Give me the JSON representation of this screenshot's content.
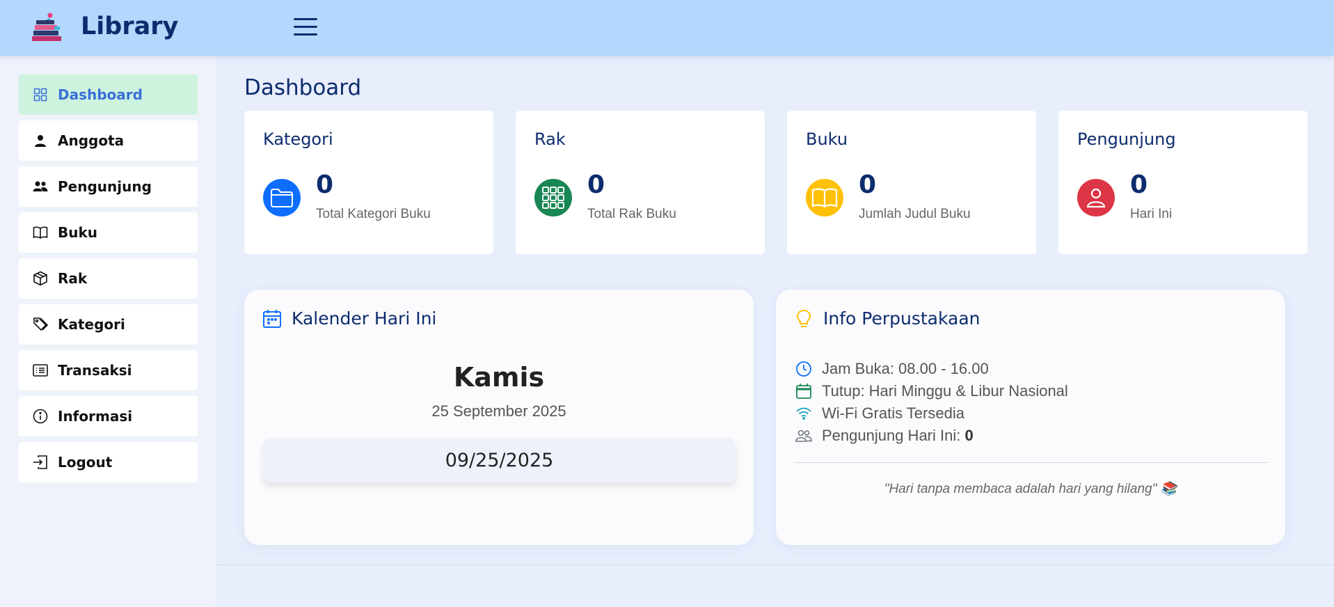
{
  "header": {
    "brand": "Library"
  },
  "sidebar": {
    "items": [
      {
        "label": "Dashboard",
        "icon": "grid-icon",
        "active": true
      },
      {
        "label": "Anggota",
        "icon": "person-icon"
      },
      {
        "label": "Pengunjung",
        "icon": "people-icon"
      },
      {
        "label": "Buku",
        "icon": "book-icon"
      },
      {
        "label": "Rak",
        "icon": "box-icon"
      },
      {
        "label": "Kategori",
        "icon": "tags-icon"
      },
      {
        "label": "Transaksi",
        "icon": "list-icon"
      },
      {
        "label": "Informasi",
        "icon": "info-icon"
      },
      {
        "label": "Logout",
        "icon": "logout-icon"
      }
    ]
  },
  "main": {
    "title": "Dashboard",
    "cards": [
      {
        "title": "Kategori",
        "value": "0",
        "subtitle": "Total Kategori Buku",
        "color": "#0d6efd",
        "icon": "folder-icon"
      },
      {
        "title": "Rak",
        "value": "0",
        "subtitle": "Total Rak Buku",
        "color": "#198754",
        "icon": "grid-3x3-icon"
      },
      {
        "title": "Buku",
        "value": "0",
        "subtitle": "Jumlah Judul Buku",
        "color": "#ffc107",
        "icon": "open-book-icon"
      },
      {
        "title": "Pengunjung",
        "value": "0",
        "subtitle": "Hari Ini",
        "color": "#dc3545",
        "icon": "person-circle-icon"
      }
    ],
    "calendar": {
      "title": "Kalender Hari Ini",
      "day": "Kamis",
      "date_long": "25 September 2025",
      "date_short": "09/25/2025"
    },
    "info": {
      "title": "Info Perpustakaan",
      "rows": [
        {
          "text": "Jam Buka: 08.00 - 16.00",
          "icon": "clock-icon"
        },
        {
          "text": "Tutup: Hari Minggu & Libur Nasional",
          "icon": "calendar-icon"
        },
        {
          "text": "Wi-Fi Gratis Tersedia",
          "icon": "wifi-icon"
        },
        {
          "text_prefix": "Pengunjung Hari Ini: ",
          "text_value": "0",
          "icon": "people-outline-icon"
        }
      ],
      "quote": "\"Hari tanpa membaca adalah hari yang hilang\" 📚"
    }
  }
}
